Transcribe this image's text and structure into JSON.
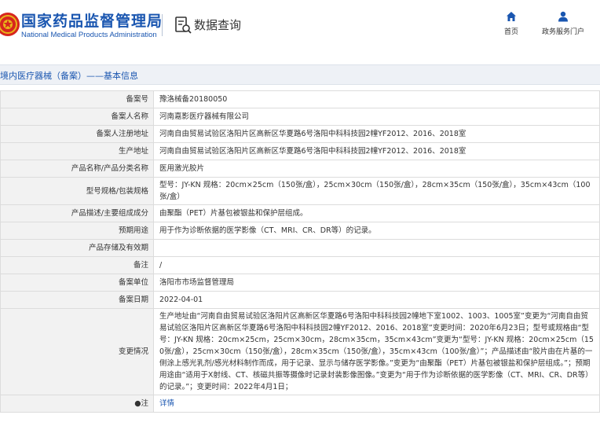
{
  "header": {
    "brand_cn": "国家药品监督管理局",
    "brand_en": "National Medical Products Administration",
    "page_title": "数据查询",
    "nav": {
      "home": "首页",
      "portal": "政务服务门户"
    }
  },
  "breadcrumb": "境内医疗器械（备案）——基本信息",
  "rows": [
    {
      "label": "备案号",
      "value": "豫洛械备20180050"
    },
    {
      "label": "备案人名称",
      "value": "河南嘉影医疗器械有限公司"
    },
    {
      "label": "备案人注册地址",
      "value": "河南自由贸易试验区洛阳片区高新区华夏路6号洛阳中科科技园2幢YF2012、2016、2018室"
    },
    {
      "label": "生产地址",
      "value": "河南自由贸易试验区洛阳片区高新区华夏路6号洛阳中科科技园2幢YF2012、2016、2018室"
    },
    {
      "label": "产品名称/产品分类名称",
      "value": "医用激光胶片"
    },
    {
      "label": "型号规格/包装规格",
      "value": "型号：JY-KN 规格：20cm×25cm（150张/盒），25cm×30cm（150张/盒），28cm×35cm（150张/盒），35cm×43cm（100张/盒）"
    },
    {
      "label": "产品描述/主要组成成分",
      "value": "由聚酯（PET）片基包被银盐和保护层组成。"
    },
    {
      "label": "预期用途",
      "value": "用于作为诊断依据的医学影像（CT、MRI、CR、DR等）的记录。"
    },
    {
      "label": "产品存储及有效期",
      "value": ""
    },
    {
      "label": "备注",
      "value": "/"
    },
    {
      "label": "备案单位",
      "value": "洛阳市市场监督管理局"
    },
    {
      "label": "备案日期",
      "value": "2022-04-01"
    },
    {
      "label": "变更情况",
      "value": "生产地址由“河南自由贸易试验区洛阳片区高新区华夏路6号洛阳中科科技园2幢地下室1002、1003、1005室”变更为“河南自由贸易试验区洛阳片区高新区华夏路6号洛阳中科科技园2幢YF2012、2016、2018室”变更时间：2020年6月23日；型号或规格由“型号：JY-KN 规格：20cm×25cm，25cm×30cm，28cm×35cm，35cm×43cm”变更为“型号：JY-KN 规格：20cm×25cm（150张/盒），25cm×30cm（150张/盒），28cm×35cm（150张/盒），35cm×43cm（100张/盒）”；产品描述由“胶片由在片基的一侧涂上感光乳剂/感光材料制作而成，用于记录、显示与储存医学影像。”变更为“由聚酯（PET）片基包被银盐和保护层组成。”；预期用途由“适用于X射线、CT、核磁共振等摄像时记录封装影像图像。”变更为“用于作为诊断依据的医学影像（CT、MRI、CR、DR等）的记录。”；变更时间：2022年4月1日；"
    },
    {
      "label": "●注",
      "value": "详情",
      "link": true
    }
  ],
  "colors": {
    "brand_blue": "#1a56b0",
    "logo_red": "#d7261e",
    "logo_gold": "#e8b61a"
  }
}
